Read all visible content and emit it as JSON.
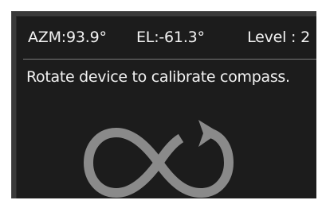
{
  "header": {
    "azimuth": "AZM:93.9°",
    "elevation": "EL:-61.3°",
    "level": "Level : 2"
  },
  "message": "Rotate device to calibrate compass.",
  "icon": {
    "name": "figure-eight-calibration-icon",
    "color": "#8a8a8a"
  },
  "colors": {
    "background": "#1c1c1c",
    "bezel": "#3a3a3a",
    "text": "#f2f2f2"
  }
}
